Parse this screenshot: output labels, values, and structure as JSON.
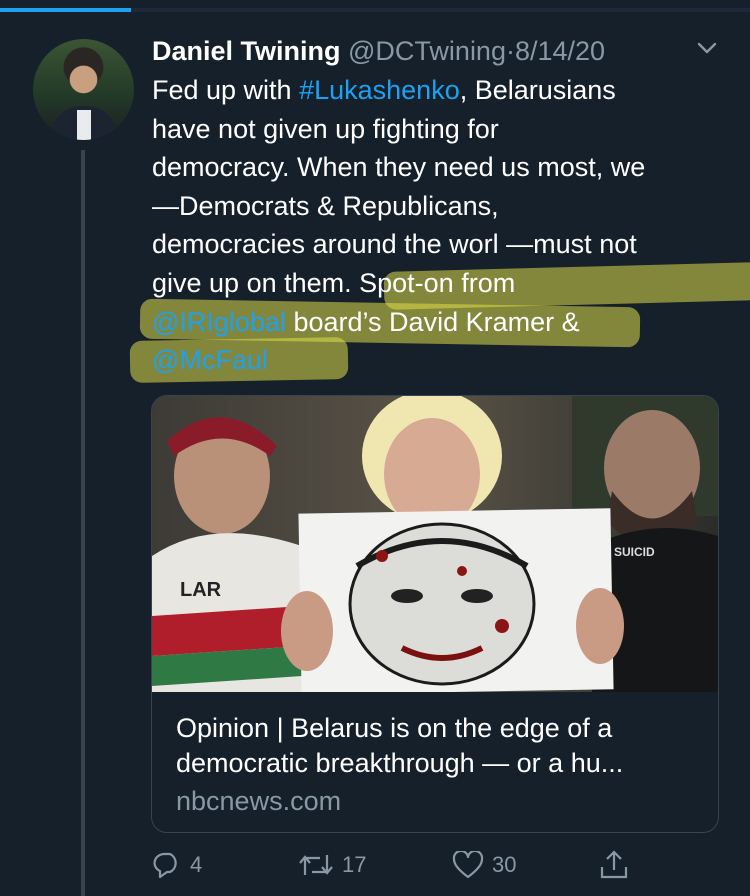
{
  "tweet": {
    "author_name": "Daniel Twining",
    "author_handle": "@DCTwining",
    "separator": "·",
    "date": "8/14/20",
    "lines": [
      {
        "before": "Fed up with ",
        "link": "#Lukashenko",
        "after": ", Belarusians"
      },
      {
        "text": "have not given up fighting for"
      },
      {
        "text": "democracy. When they need us most, we"
      },
      {
        "text": "—Democrats & Republicans,"
      },
      {
        "text": "democracies around the worl —must not"
      },
      {
        "before": "give up on them. S",
        "after": "pot-on from"
      },
      {
        "link": "@IRIglobal",
        "after": " board’s David Kramer &"
      },
      {
        "link": "@McFaul"
      }
    ]
  },
  "card": {
    "title_line1": "Opinion | Belarus is on the edge of a",
    "title_line2": "democratic breakthrough — or a hu...",
    "domain": "nbcnews.com",
    "image_sign_text": "SUICID",
    "image_shirt_text": "LAR"
  },
  "actions": {
    "replies": "4",
    "retweets": "17",
    "likes": "30"
  },
  "colors": {
    "background": "#15202b",
    "link": "#1da1f2",
    "secondary_text": "#8899a6",
    "highlighter": "#dedc48"
  }
}
